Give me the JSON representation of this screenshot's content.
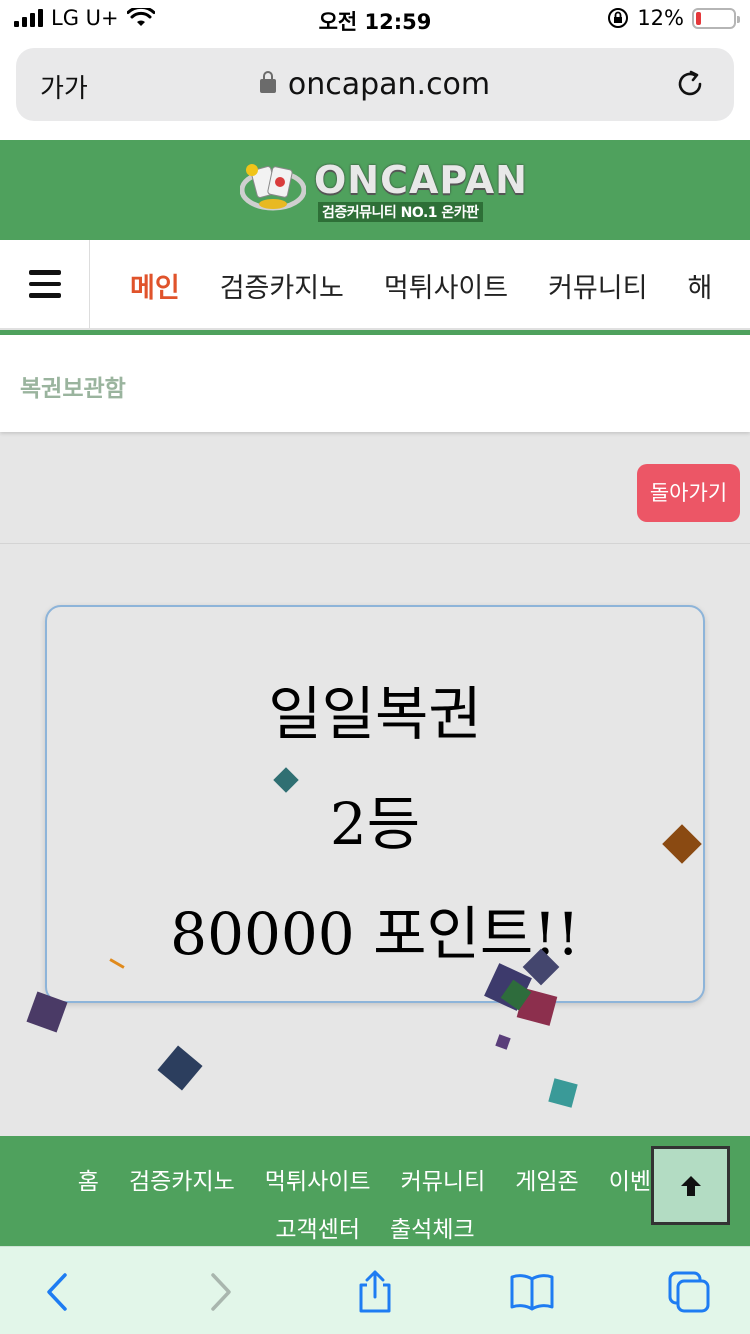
{
  "status": {
    "carrier": "LG U+",
    "time": "오전 12:59",
    "battery": "12%"
  },
  "browser": {
    "text_size_label": "가가",
    "url": "oncapan.com"
  },
  "site": {
    "logo_text": "ONCAPAN",
    "logo_sub": "검증커뮤니티 NO.1 온카판",
    "nav": [
      "메인",
      "검증카지노",
      "먹튀사이트",
      "커뮤니티",
      "해"
    ],
    "breadcrumb": "복권보관함",
    "back_label": "돌아가기"
  },
  "result": {
    "line1": "일일복권",
    "line2": "2등",
    "line3": "80000 포인트!!"
  },
  "footer": {
    "row1": [
      "홈",
      "검증카지노",
      "먹튀사이트",
      "커뮤니티",
      "게임존",
      "이벤트"
    ],
    "row2": [
      "고객센터",
      "출석체크"
    ]
  },
  "colors": {
    "brand_green": "#4fa15d",
    "active_nav": "#e0532b",
    "back_button": "#ec5666",
    "toolbar_blue": "#1e7cf2"
  }
}
